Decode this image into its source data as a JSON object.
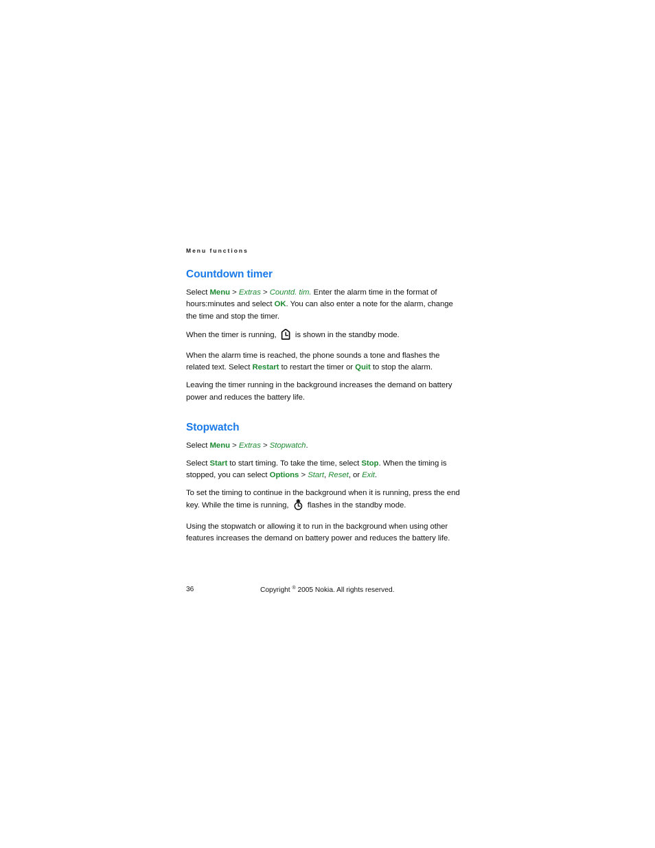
{
  "document": {
    "running_header": "Menu functions",
    "colors": {
      "heading_blue": "#1a7ae8",
      "accent_green": "#1d8a32",
      "body_text": "#111111",
      "page_background": "#ffffff"
    }
  },
  "sections": [
    {
      "heading": "Countdown timer",
      "paragraphs": {
        "p1": {
          "t1": "Select ",
          "cmd1": "Menu",
          "sep1": " > ",
          "item1": "Extras",
          "sep2": " > ",
          "item2": "Countd. tim.",
          "t2": " Enter the alarm time in the format of hours:minutes and select ",
          "cmd2": "OK",
          "t3": ". You can also enter a note for the alarm, change the time and stop the timer."
        },
        "p2": {
          "t1": "When the timer is running, ",
          "icon": "countdown-timer-icon",
          "t2": " is shown in the standby mode."
        },
        "p3": {
          "t1": "When the alarm time is reached, the phone sounds a tone and flashes the related text. Select ",
          "cmd1": "Restart",
          "t2": " to restart the timer or ",
          "cmd2": "Quit",
          "t3": " to stop the alarm."
        },
        "p4": {
          "t1": "Leaving the timer running in the background increases the demand on battery power and reduces the battery life."
        }
      }
    },
    {
      "heading": "Stopwatch",
      "paragraphs": {
        "p1": {
          "t1": "Select ",
          "cmd1": "Menu",
          "sep1": " > ",
          "item1": "Extras",
          "sep2": " > ",
          "item2": "Stopwatch",
          "t2": "."
        },
        "p2": {
          "t1": "Select ",
          "cmd1": "Start",
          "t2": " to start timing. To take the time, select ",
          "cmd2": "Stop",
          "t3": ". When the timing is stopped, you can select ",
          "cmd3": "Options",
          "sep1": " > ",
          "item1": "Start",
          "t4": ", ",
          "item2": "Reset",
          "t5": ", or ",
          "item3": "Exit",
          "t6": "."
        },
        "p3": {
          "t1": "To set the timing to continue in the background when it is running, press the end key. While the time is running, ",
          "icon": "stopwatch-icon",
          "t2": " flashes in the standby mode."
        },
        "p4": {
          "t1": "Using the stopwatch or allowing it to run in the background when using other features increases the demand on battery power and reduces the battery life."
        }
      }
    }
  ],
  "footer": {
    "page_number": "36",
    "copyright_prefix": "Copyright ",
    "copyright_symbol": "®",
    "copyright_suffix": " 2005 Nokia. All rights reserved."
  }
}
